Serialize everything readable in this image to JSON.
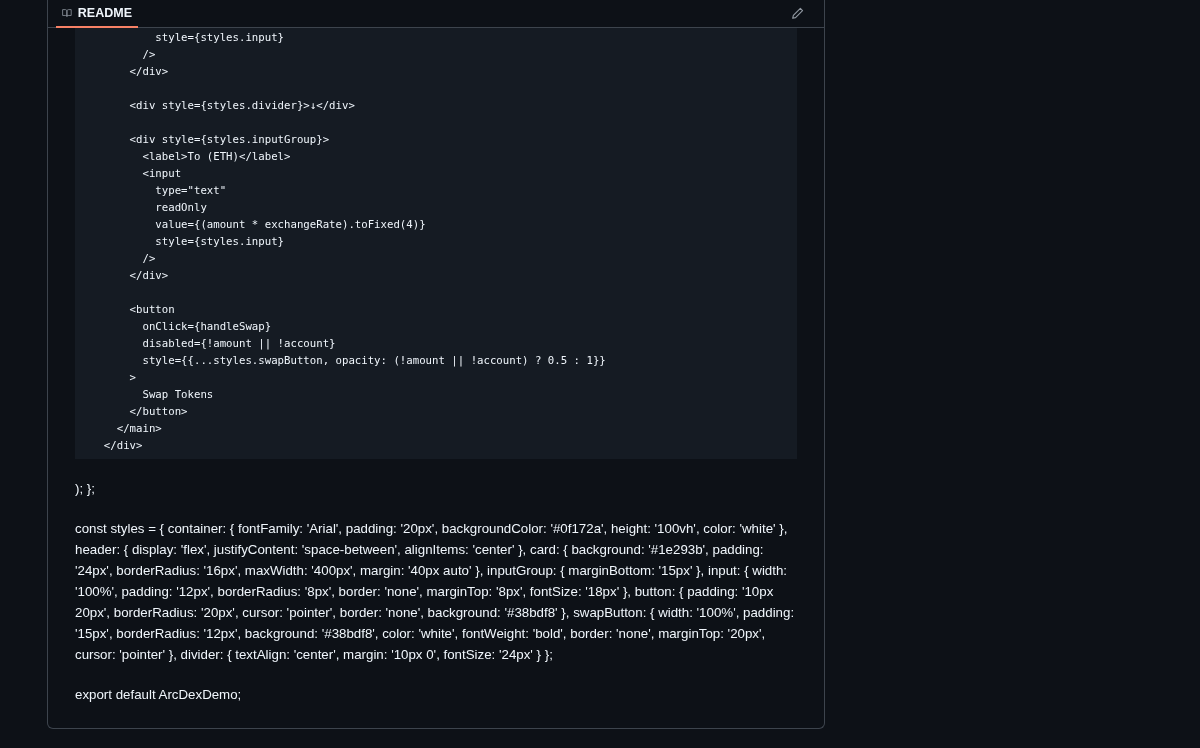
{
  "readme": {
    "tab": {
      "label": "README",
      "selected": true
    },
    "code_blocks": [
      {
        "lines": [
          "          style={styles.input}",
          "        />",
          "      </div>"
        ]
      },
      {
        "lines": [
          "      <div style={styles.divider}>↓</div>"
        ]
      },
      {
        "lines": [
          "      <div style={styles.inputGroup}>",
          "        <label>To (ETH)</label>",
          "        <input",
          "          type=\"text\"",
          "          readOnly",
          "          value={(amount * exchangeRate).toFixed(4)}",
          "          style={styles.input}",
          "        />",
          "      </div>"
        ]
      },
      {
        "lines": [
          "      <button",
          "        onClick={handleSwap}",
          "        disabled={!amount || !account}",
          "        style={{...styles.swapButton, opacity: (!amount || !account) ? 0.5 : 1}}",
          "      >",
          "        Swap Tokens",
          "      </button>",
          "    </main>",
          "  </div>"
        ]
      }
    ],
    "paragraphs": [
      "); };",
      "const styles = { container: { fontFamily: 'Arial', padding: '20px', backgroundColor: '#0f172a', height: '100vh', color: 'white' }, header: { display: 'flex', justifyContent: 'space-between', alignItems: 'center' }, card: { background: '#1e293b', padding: '24px', borderRadius: '16px', maxWidth: '400px', margin: '40px auto' }, inputGroup: { marginBottom: '15px' }, input: { width: '100%', padding: '12px', borderRadius: '8px', border: 'none', marginTop: '8px', fontSize: '18px' }, button: { padding: '10px 20px', borderRadius: '20px', cursor: 'pointer', border: 'none', background: '#38bdf8' }, swapButton: { width: '100%', padding: '15px', borderRadius: '12px', background: '#38bdf8', color: 'white', fontWeight: 'bold', border: 'none', marginTop: '20px', cursor: 'pointer' }, divider: { textAlign: 'center', margin: '10px 0', fontSize: '24px' } };",
      "export default ArcDexDemo;"
    ]
  }
}
